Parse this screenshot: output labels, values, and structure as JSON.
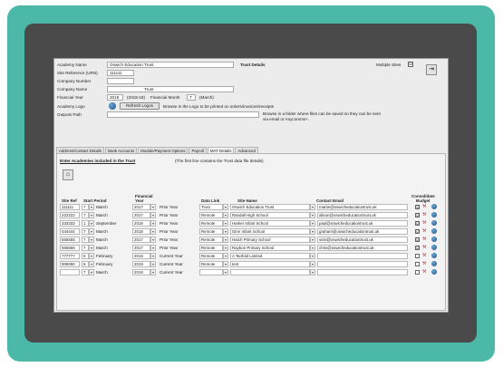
{
  "form": {
    "academy_name_label": "Academy Name",
    "academy_name_value": "Oswich Education Trust",
    "trust_details_label": "Trust Details",
    "multiple_sites_label": "Multiple Sites",
    "multiple_sites_checked": "☑",
    "site_ref_label": "Site Reference (URN)",
    "site_ref_value": "111111",
    "company_number_label": "Company Number",
    "company_number_value": "",
    "company_name_label": "Company Name",
    "company_name_value": "Trust",
    "financial_year_label": "Financial Year",
    "financial_year_value": "2019",
    "financial_year_range": "(2018-19)",
    "financial_month_label": "Financial Month",
    "financial_month_value": "7",
    "financial_month_name": "(March)",
    "academy_logo_label": "Academy Logo",
    "refresh_logos_label": "Refresh Logos",
    "logo_hint": "Browse in the Logo to be printed on orders/invoices/receipts",
    "outputs_path_label": "Outputs Path",
    "outputs_path_value": "",
    "outputs_hint_1": "Browse in a folder where files can be saved so they can be sent",
    "outputs_hint_2": "via email or Anycomms+."
  },
  "tabs": [
    {
      "label": "Address/Contact Details"
    },
    {
      "label": "Bank Accounts"
    },
    {
      "label": "Module/Payment Options"
    },
    {
      "label": "Payroll"
    },
    {
      "label": "MAT Details"
    },
    {
      "label": "Advanced"
    }
  ],
  "mat": {
    "heading": "Enter Academies included in the Trust",
    "note": "(The first line contains the Trust data file details).",
    "columns": {
      "site_ref": "Site Ref",
      "start_period": "Start Period",
      "financial_year_1": "Financial",
      "financial_year_2": "Year",
      "data_link": "Data Link",
      "site_name": "Site Name",
      "contact_email": "Contact Email",
      "consolidate_1": "Consolidate",
      "consolidate_2": "Budget"
    },
    "rows": [
      {
        "ref": "111111",
        "period": "7",
        "month": "March",
        "year": "2017",
        "yeartype": "Prior Year",
        "link": "Trust",
        "name": "Oswich Education Trust",
        "email": "martin@oswicheducationtrust.uk",
        "consolidate": "☑"
      },
      {
        "ref": "222222",
        "period": "7",
        "month": "March",
        "year": "2017",
        "yeartype": "Prior Year",
        "link": "Remote",
        "name": "Randall High School",
        "email": "alison@oswicheducationtrust.uk",
        "consolidate": "☑"
      },
      {
        "ref": "333333",
        "period": "1",
        "month": "September",
        "year": "2018",
        "yeartype": "Prior Year",
        "link": "Remote",
        "name": "Harker Infant School",
        "email": "paul@oswicheducationtrust.uk",
        "consolidate": "☑"
      },
      {
        "ref": "444444",
        "period": "7",
        "month": "March",
        "year": "2018",
        "yeartype": "Prior Year",
        "link": "Remote",
        "name": "Ginn Infant School",
        "email": "graham@oswicheducationtrust.uk",
        "consolidate": "☑"
      },
      {
        "ref": "555555",
        "period": "7",
        "month": "March",
        "year": "2017",
        "yeartype": "Prior Year",
        "link": "Remote",
        "name": "Hatch Primary School",
        "email": "vicki@oswicheducationtrust.uk",
        "consolidate": "☑"
      },
      {
        "ref": "666666",
        "period": "7",
        "month": "March",
        "year": "2017",
        "yeartype": "Prior Year",
        "link": "Remote",
        "name": "Raybon Primary School",
        "email": "chris@oswicheducationtrust.uk",
        "consolidate": "☑"
      },
      {
        "ref": "777777",
        "period": "6",
        "month": "February",
        "year": "2019",
        "yeartype": "Current Year",
        "link": "Remote",
        "name": "A Tanfold Limited",
        "email": "",
        "consolidate": ""
      },
      {
        "ref": "909090",
        "period": "6",
        "month": "February",
        "year": "2019",
        "yeartype": "Current Year",
        "link": "Remote",
        "name": "test",
        "email": "",
        "consolidate": ""
      },
      {
        "ref": "",
        "period": "7",
        "month": "March",
        "year": "2019",
        "yeartype": "Current Year",
        "link": "",
        "name": "",
        "email": "",
        "consolidate": ""
      }
    ]
  },
  "icons": {
    "dropdown": "▾",
    "home": "⌂",
    "exit": "⇥",
    "tools": "⚒"
  },
  "colors": {
    "frame_teal": "#4cb8a8",
    "frame_dark": "#4a4a4a",
    "window_bg": "#ececec"
  }
}
